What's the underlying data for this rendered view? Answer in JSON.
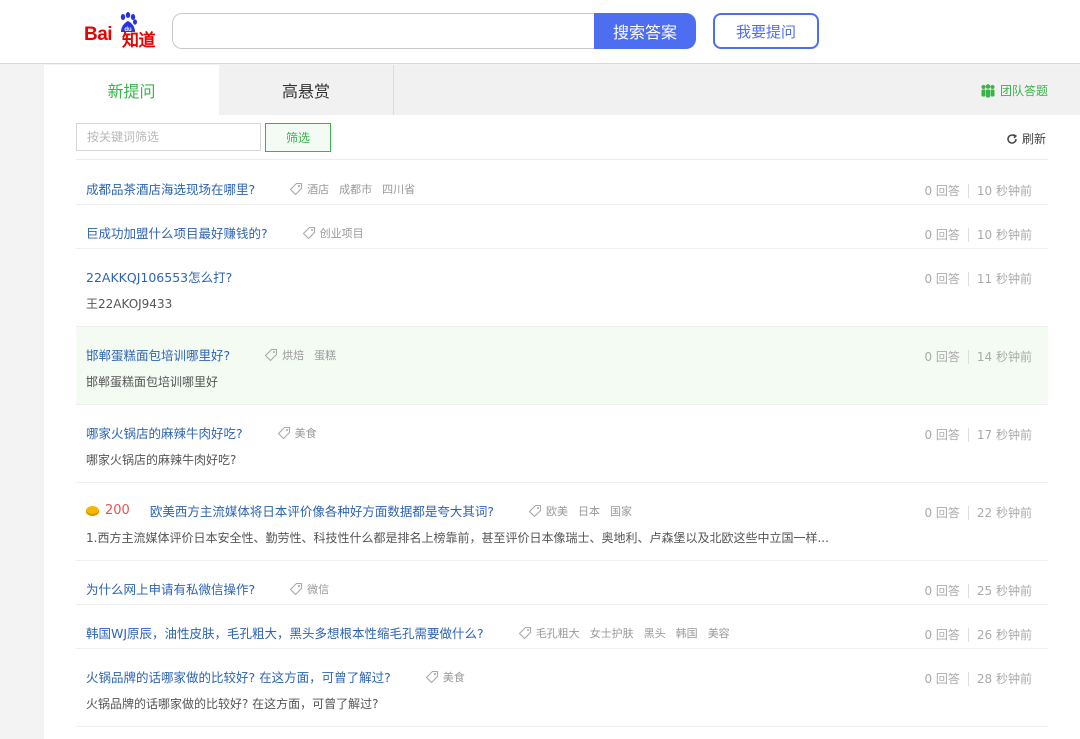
{
  "header": {
    "logo_text_1": "Bai",
    "logo_text_2": "知道",
    "search_value": "",
    "search_button": "搜索答案",
    "ask_button": "我要提问"
  },
  "tabs": [
    {
      "label": "新提问",
      "active": true
    },
    {
      "label": "高悬赏",
      "active": false
    }
  ],
  "team_label": "团队答题",
  "filter": {
    "placeholder": "按关键词筛选",
    "button": "筛选"
  },
  "refresh_label": "刷新",
  "questions": [
    {
      "title": "成都品茶酒店海选现场在哪里?",
      "tags": [
        "酒店",
        "成都市",
        "四川省"
      ],
      "desc": "",
      "answers": "0 回答",
      "time": "10 秒钟前",
      "highlighted": false
    },
    {
      "title": "巨成功加盟什么项目最好赚钱的?",
      "tags": [
        "创业项目"
      ],
      "desc": "",
      "answers": "0 回答",
      "time": "10 秒钟前",
      "highlighted": false
    },
    {
      "title": "22AKKQJ106553怎么打?",
      "tags": [],
      "desc": "王22AKOJ9433",
      "answers": "0 回答",
      "time": "11 秒钟前",
      "highlighted": false
    },
    {
      "title": "邯郸蛋糕面包培训哪里好?",
      "tags": [
        "烘焙",
        "蛋糕"
      ],
      "desc": "邯郸蛋糕面包培训哪里好",
      "answers": "0 回答",
      "time": "14 秒钟前",
      "highlighted": true
    },
    {
      "title": "哪家火锅店的麻辣牛肉好吃?",
      "tags": [
        "美食"
      ],
      "desc": "哪家火锅店的麻辣牛肉好吃?",
      "answers": "0 回答",
      "time": "17 秒钟前",
      "highlighted": false
    },
    {
      "title": "欧美西方主流媒体将日本评价像各种好方面数据都是夸大其词?",
      "reward": "200",
      "tags": [
        "欧美",
        "日本",
        "国家"
      ],
      "desc": "1.西方主流媒体评价日本安全性、勤劳性、科技性什么都是排名上榜靠前，甚至评价日本像瑞士、奥地利、卢森堡以及北欧这些中立国一样...",
      "answers": "0 回答",
      "time": "22 秒钟前",
      "highlighted": false
    },
    {
      "title": "为什么网上申请有私微信操作?",
      "tags": [
        "微信"
      ],
      "desc": "",
      "answers": "0 回答",
      "time": "25 秒钟前",
      "highlighted": false
    },
    {
      "title": "韩国WJ原辰，油性皮肤，毛孔粗大，黑头多想根本性缩毛孔需要做什么?",
      "tags": [
        "毛孔粗大",
        "女士护肤",
        "黑头",
        "韩国",
        "美容"
      ],
      "desc": "",
      "answers": "0 回答",
      "time": "26 秒钟前",
      "highlighted": false
    },
    {
      "title": "火锅品牌的话哪家做的比较好? 在这方面，可曾了解过?",
      "tags": [
        "美食"
      ],
      "desc": "火锅品牌的话哪家做的比较好? 在这方面，可曾了解过?",
      "answers": "0 回答",
      "time": "28 秒钟前",
      "highlighted": false
    }
  ]
}
